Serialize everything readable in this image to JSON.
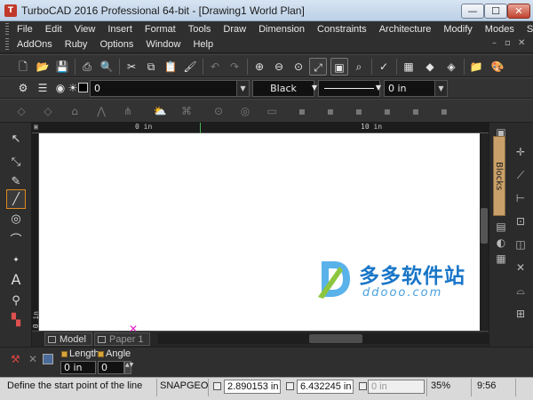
{
  "window": {
    "title": "TurboCAD 2016 Professional 64-bit - [Drawing1 World Plan]",
    "minimize": "—",
    "maximize": "☐",
    "close": "✕"
  },
  "menu": {
    "row1": [
      "File",
      "Edit",
      "View",
      "Insert",
      "Format",
      "Tools",
      "Draw",
      "Dimension",
      "Constraints",
      "Architecture",
      "Modify",
      "Modes",
      "SDK"
    ],
    "row2": [
      "AddOns",
      "Ruby",
      "Options",
      "Window",
      "Help"
    ],
    "mdi_controls": [
      "–",
      "▫",
      "✕"
    ]
  },
  "property_bar": {
    "layer_value": "0",
    "color_value": "Black",
    "thickness_value": "0 in"
  },
  "ruler": {
    "labels": [
      "0 in",
      "0 in",
      "10 in"
    ],
    "left_labels": [
      "0 in"
    ]
  },
  "toolbox": {
    "icons": [
      "select-arrow-icon",
      "edit-tool-icon",
      "brush-icon",
      "line-icon",
      "circle-icon",
      "arc-icon",
      "point-icon",
      "text-icon",
      "paint-bucket-icon",
      "layers-icon"
    ]
  },
  "tabs": {
    "model": "Model",
    "paper": "Paper 1"
  },
  "blocks_panel": {
    "label": "Blocks"
  },
  "inspector": {
    "length_label": "Length",
    "angle_label": "Angle",
    "length_value": "0 in",
    "angle_value": "0"
  },
  "status": {
    "prompt": "Define the start point of the line",
    "snap": "SNAP",
    "geo": "GEO",
    "x_value": "2.890153 in",
    "y_value": "6.432245 in",
    "z_value": "0 in",
    "zoom": "35%",
    "time": "9:56"
  },
  "watermark": {
    "title": "多多软件站",
    "url": "ddooo.com"
  },
  "colors": {
    "accent_orange": "#e08a1e",
    "watermark_blue": "#1976c8"
  }
}
